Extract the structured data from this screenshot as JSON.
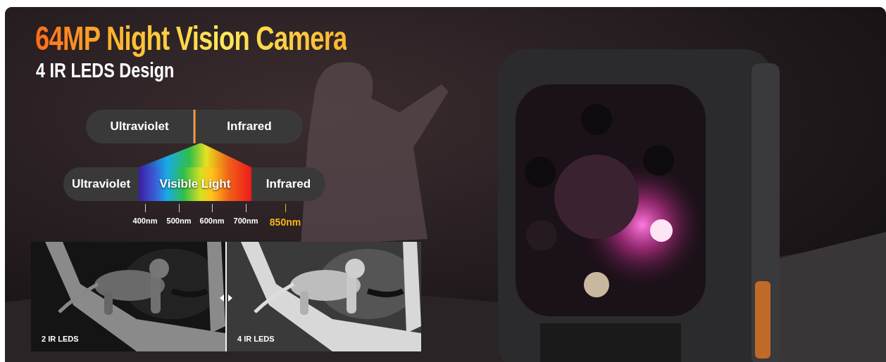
{
  "headline": "64MP Night Vision Camera",
  "subheadline": "4 IR LEDS Design",
  "spectrum": {
    "top_bar": [
      "Ultraviolet",
      "Infrared"
    ],
    "bottom_bar": {
      "left": "Ultraviolet",
      "center": "Visible Light",
      "right": "Infrared"
    },
    "ticks": [
      {
        "label": "400nm",
        "highlight": false
      },
      {
        "label": "500nm",
        "highlight": false
      },
      {
        "label": "600nm",
        "highlight": false
      },
      {
        "label": "700nm",
        "highlight": false
      },
      {
        "label": "850nm",
        "highlight": true
      }
    ]
  },
  "comparison": [
    {
      "label": "2 IR LEDS",
      "kind": "picture",
      "sharp": false
    },
    {
      "label": "4 IR LEDS",
      "kind": "picture",
      "sharp": true
    }
  ]
}
